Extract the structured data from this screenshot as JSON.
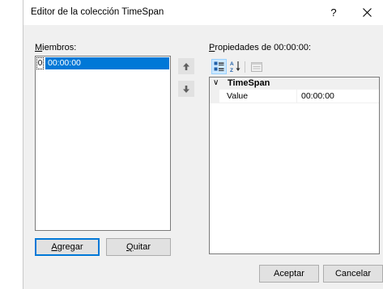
{
  "window": {
    "title": "Editor de la colección TimeSpan",
    "help_glyph": "?",
    "close_icon": "close-icon"
  },
  "members": {
    "label_accel": "M",
    "label_rest": "iembros:",
    "items": [
      {
        "index": "0",
        "value": "00:00:00",
        "selected": true
      }
    ],
    "move_up_icon": "arrow-up-icon",
    "move_down_icon": "arrow-down-icon",
    "add_label_accel": "A",
    "add_label_rest": "gregar",
    "remove_label_accel": "Q",
    "remove_label_rest": "uitar"
  },
  "properties": {
    "label_accel": "P",
    "label_rest": "ropiedades de 00:00:00:",
    "toolbar": {
      "categorized_icon": "categorized-icon",
      "alphabetical_icon": "sort-alphabetical-icon",
      "property_pages_icon": "property-pages-icon"
    },
    "category": {
      "chevron": "∨",
      "name": "TimeSpan"
    },
    "rows": [
      {
        "name": "Value",
        "value": "00:00:00"
      }
    ]
  },
  "footer": {
    "ok_label": "Aceptar",
    "cancel_label": "Cancelar"
  },
  "colors": {
    "selection": "#0078d7",
    "dialog_bg": "#f0f0f0",
    "button_bg": "#e1e1e1"
  }
}
